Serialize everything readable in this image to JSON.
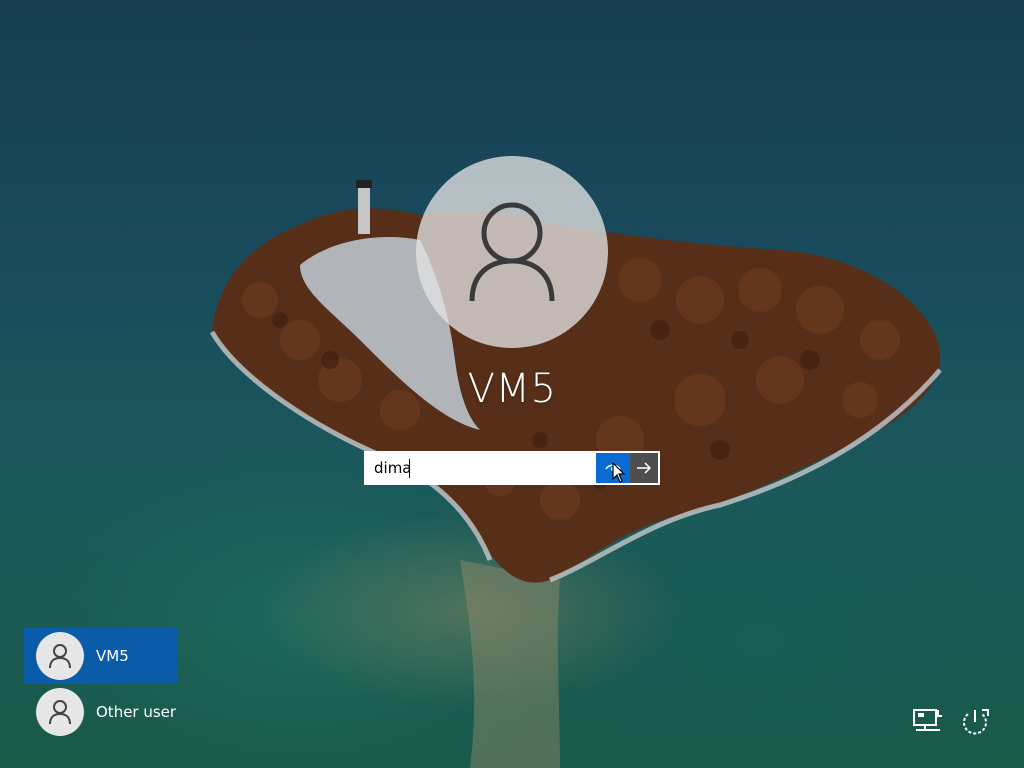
{
  "login": {
    "username": "VM5",
    "password_value": "dima"
  },
  "user_list": [
    {
      "label": "VM5",
      "selected": true
    },
    {
      "label": "Other user",
      "selected": false
    }
  ],
  "icons": {
    "avatar": "user-icon",
    "reveal": "eye-icon",
    "submit": "arrow-right-icon",
    "network": "network-icon",
    "power": "power-icon",
    "cursor": "mouse-pointer-icon"
  },
  "colors": {
    "accent": "#0a6bd3",
    "selected_tile": "#0a5ba8",
    "submit_button": "#4e4e4e"
  }
}
